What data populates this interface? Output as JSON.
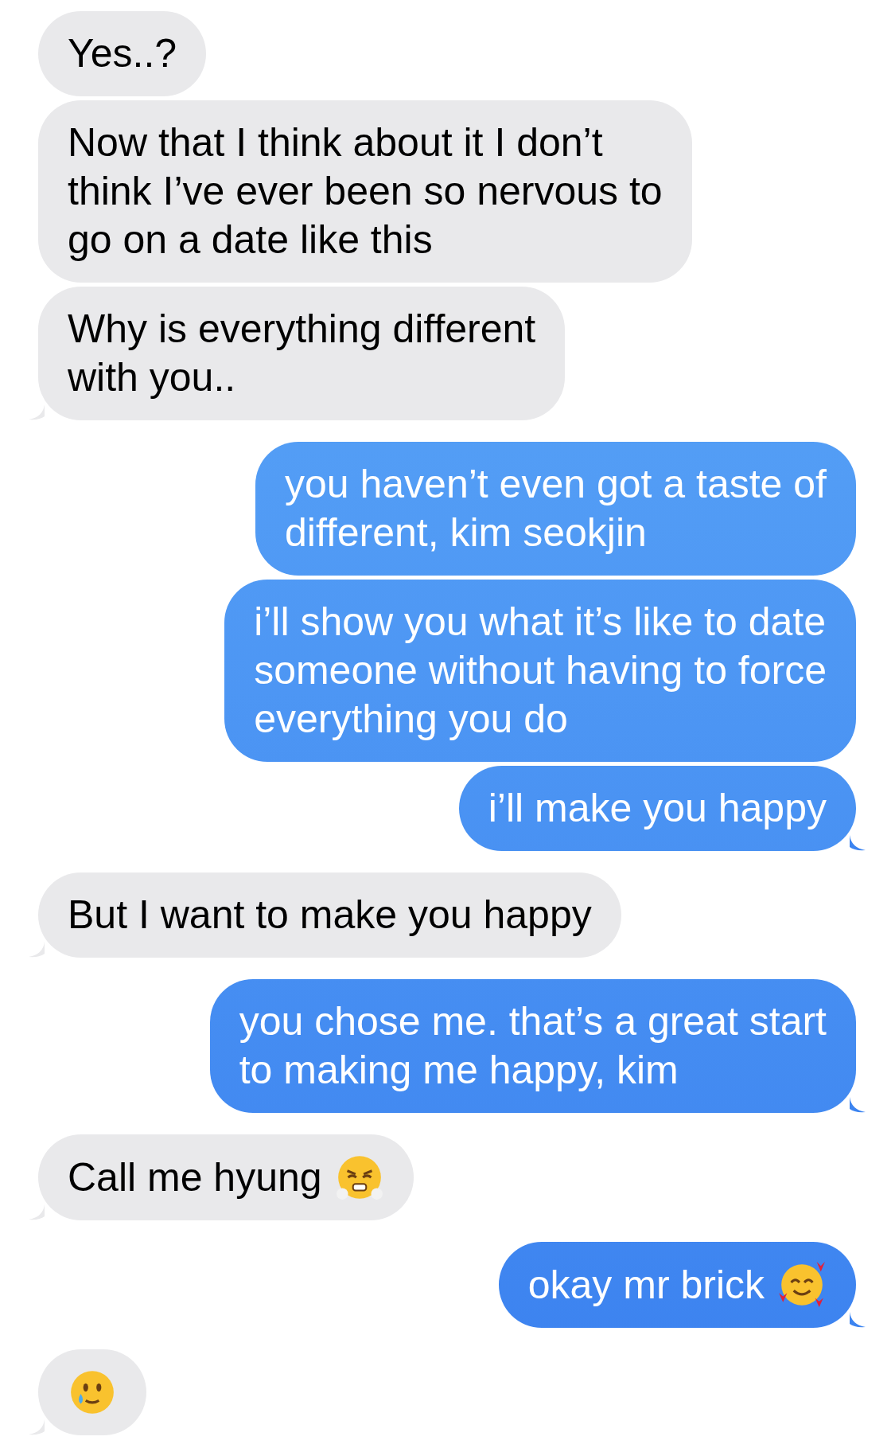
{
  "messages": [
    {
      "kind": "received",
      "tail": false,
      "lines": [
        "Yes..?"
      ]
    },
    {
      "kind": "received",
      "tail": false,
      "lines": [
        "Now that I think about it I don’t",
        "think I’ve ever been so nervous to",
        "go on a date like this"
      ]
    },
    {
      "kind": "received",
      "tail": true,
      "lines": [
        "Why is everything different",
        "with you.."
      ]
    },
    {
      "kind": "sent",
      "tail": false,
      "lines": [
        "you haven’t even got a taste of",
        "different, kim seokjin"
      ]
    },
    {
      "kind": "sent",
      "tail": false,
      "lines": [
        "i’ll show you what it’s like to date",
        "someone without having to force",
        "everything you do"
      ]
    },
    {
      "kind": "sent",
      "tail": true,
      "lines": [
        "i’ll make you happy"
      ]
    },
    {
      "kind": "received",
      "tail": true,
      "lines": [
        "But I want to make you happy"
      ]
    },
    {
      "kind": "sent",
      "tail": true,
      "lines": [
        "you chose me. that’s a great start",
        "to making me happy, kim"
      ]
    },
    {
      "kind": "received",
      "tail": true,
      "lines": [
        "Call me hyung"
      ],
      "emoji": true
    },
    {
      "kind": "sent",
      "tail": true,
      "lines": [
        "okay mr brick"
      ],
      "emoji": true
    },
    {
      "kind": "received",
      "tail": true,
      "emoji": true
    }
  ]
}
